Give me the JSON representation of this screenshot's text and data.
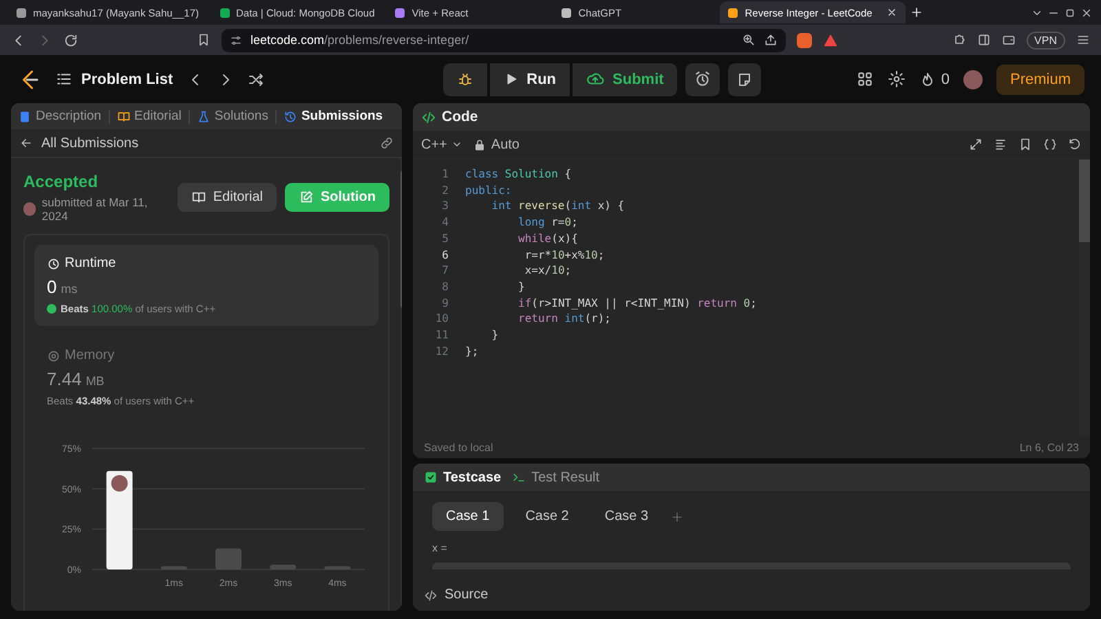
{
  "browser": {
    "tabs": [
      {
        "title": "mayanksahu17 (Mayank Sahu__17)",
        "selected": false
      },
      {
        "title": "Data | Cloud: MongoDB Cloud",
        "selected": false
      },
      {
        "title": "Vite + React",
        "selected": false
      },
      {
        "title": "ChatGPT",
        "selected": false
      },
      {
        "title": "Reverse Integer - LeetCode",
        "selected": true
      }
    ],
    "url_host": "leetcode.com",
    "url_path": "/problems/reverse-integer/",
    "vpn": "VPN"
  },
  "header": {
    "problem_list": "Problem List",
    "run": "Run",
    "submit": "Submit",
    "streak": "0",
    "premium": "Premium"
  },
  "left": {
    "tabs": [
      {
        "label": "Description",
        "selected": false
      },
      {
        "label": "Editorial",
        "selected": false
      },
      {
        "label": "Solutions",
        "selected": false
      },
      {
        "label": "Submissions",
        "selected": true
      }
    ],
    "back": "All Submissions",
    "status": "Accepted",
    "submitted": "submitted at Mar 11, 2024",
    "editorial_button": "Editorial",
    "solution_button": "Solution",
    "metrics": [
      {
        "kind": "runtime",
        "title": "Runtime",
        "selected": true,
        "value": "0",
        "unit": "ms",
        "beats": [
          "Beats",
          "100.00%",
          "of users with C++"
        ]
      },
      {
        "kind": "memory",
        "title": "Memory",
        "selected": false,
        "value": "7.44",
        "unit": "MB",
        "beats": [
          "Beats",
          "43.48%",
          "of users with C++"
        ]
      }
    ],
    "chart_data": {
      "type": "bar",
      "categories": [
        null,
        "1ms",
        "2ms",
        "3ms",
        "4ms"
      ],
      "values": [
        61,
        2,
        13,
        3,
        2
      ],
      "ylim": [
        0,
        75
      ],
      "yticks": [
        {
          "value": 0,
          "label": "0%"
        },
        {
          "value": 25,
          "label": "25%"
        },
        {
          "value": 50,
          "label": "50%"
        },
        {
          "value": 75,
          "label": "75%"
        }
      ]
    }
  },
  "code": {
    "title": "Code",
    "language": "C++",
    "mode": "Auto",
    "lines": [
      {
        "number": "1",
        "current": false,
        "tokens": [
          {
            "text": "class ",
            "kind": "kw"
          },
          {
            "text": "Solution",
            "kind": "type"
          },
          {
            "text": " {",
            "kind": "p"
          }
        ]
      },
      {
        "number": "2",
        "current": false,
        "tokens": [
          {
            "text": "public:",
            "kind": "kw"
          }
        ]
      },
      {
        "number": "3",
        "current": false,
        "tokens": [
          {
            "text": "    int",
            "kind": "kw"
          },
          {
            "text": " reverse",
            "kind": "fn"
          },
          {
            "text": "(",
            "kind": "p"
          },
          {
            "text": "int",
            "kind": "kw"
          },
          {
            "text": " x) {",
            "kind": "p"
          }
        ]
      },
      {
        "number": "4",
        "current": false,
        "tokens": [
          {
            "text": "        long",
            "kind": "kw"
          },
          {
            "text": " r=",
            "kind": "p"
          },
          {
            "text": "0",
            "kind": "num"
          },
          {
            "text": ";",
            "kind": "p"
          }
        ]
      },
      {
        "number": "5",
        "current": false,
        "tokens": [
          {
            "text": "        while",
            "kind": "ctrl"
          },
          {
            "text": "(x){",
            "kind": "p"
          }
        ]
      },
      {
        "number": "6",
        "current": true,
        "tokens": [
          {
            "text": "         r=r*",
            "kind": "p"
          },
          {
            "text": "10",
            "kind": "num"
          },
          {
            "text": "+x%",
            "kind": "p"
          },
          {
            "text": "10",
            "kind": "num"
          },
          {
            "text": ";",
            "kind": "p"
          }
        ]
      },
      {
        "number": "7",
        "current": false,
        "tokens": [
          {
            "text": "         x=x/",
            "kind": "p"
          },
          {
            "text": "10",
            "kind": "num"
          },
          {
            "text": ";",
            "kind": "p"
          }
        ]
      },
      {
        "number": "8",
        "current": false,
        "tokens": [
          {
            "text": "        }",
            "kind": "p"
          }
        ]
      },
      {
        "number": "9",
        "current": false,
        "tokens": [
          {
            "text": "        if",
            "kind": "ctrl"
          },
          {
            "text": "(r>INT_MAX || r<INT_MIN)",
            "kind": "p"
          },
          {
            "text": " return",
            "kind": "ctrl"
          },
          {
            "text": " 0",
            "kind": "num"
          },
          {
            "text": ";",
            "kind": "p"
          }
        ]
      },
      {
        "number": "10",
        "current": false,
        "tokens": [
          {
            "text": "        return",
            "kind": "ctrl"
          },
          {
            "text": " int",
            "kind": "kw"
          },
          {
            "text": "(r);",
            "kind": "p"
          }
        ]
      },
      {
        "number": "11",
        "current": false,
        "tokens": [
          {
            "text": "    }",
            "kind": "p"
          }
        ]
      },
      {
        "number": "12",
        "current": false,
        "tokens": [
          {
            "text": "};",
            "kind": "p"
          }
        ]
      }
    ],
    "saved": "Saved to local",
    "cursor": "Ln 6, Col 23"
  },
  "tests": {
    "tabs": [
      {
        "label": "Testcase",
        "selected": true
      },
      {
        "label": "Test Result",
        "selected": false
      }
    ],
    "cases": [
      {
        "label": "Case 1",
        "selected": true
      },
      {
        "label": "Case 2",
        "selected": false
      },
      {
        "label": "Case 3",
        "selected": false
      }
    ],
    "input_label": "x =",
    "source": "Source"
  }
}
